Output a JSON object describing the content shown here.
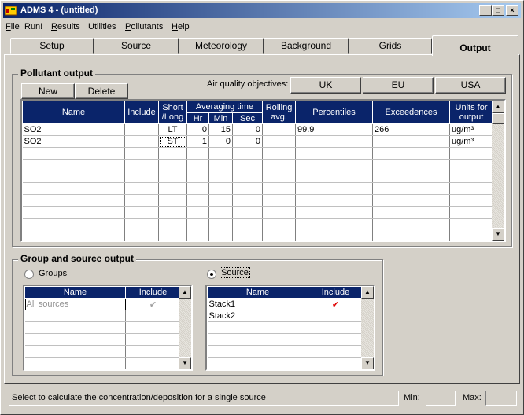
{
  "window": {
    "title": "ADMS 4 - (untitled)",
    "min_label": "_",
    "max_label": "□",
    "close_label": "×"
  },
  "menu": [
    {
      "first": "F",
      "rest": "ile"
    },
    {
      "first": "",
      "rest": "Run!"
    },
    {
      "first": "R",
      "rest": "esults"
    },
    {
      "first": "",
      "rest": "Utilities"
    },
    {
      "first": "P",
      "rest": "ollutants"
    },
    {
      "first": "H",
      "rest": "elp"
    }
  ],
  "tabs": [
    "Setup",
    "Source",
    "Meteorology",
    "Background",
    "Grids",
    "Output"
  ],
  "active_tab": "Output",
  "pollutant_output": {
    "label": "Pollutant output",
    "new_label": "New",
    "delete_label": "Delete",
    "aq_label": "Air quality objectives:",
    "uk_label": "UK",
    "eu_label": "EU",
    "usa_label": "USA",
    "headers": {
      "name": "Name",
      "include": "Include",
      "short_long_1": "Short",
      "short_long_2": "/Long",
      "averaging": "Averaging time",
      "hr": "Hr",
      "min": "Min",
      "sec": "Sec",
      "rolling_1": "Rolling",
      "rolling_2": "avg.",
      "percentiles": "Percentiles",
      "exceedences": "Exceedences",
      "units_1": "Units for",
      "units_2": "output"
    },
    "rows": [
      {
        "name": "SO2",
        "include": "",
        "sl": "LT",
        "hr": "0",
        "min": "15",
        "sec": "0",
        "rolling": "",
        "percentiles": "99.9",
        "exceedences": "266",
        "units": "ug/m³"
      },
      {
        "name": "SO2",
        "include": "",
        "sl": "ST",
        "hr": "1",
        "min": "0",
        "sec": "0",
        "rolling": "",
        "percentiles": "",
        "exceedences": "",
        "units": "ug/m³"
      }
    ]
  },
  "group_source": {
    "label": "Group and source output",
    "groups_label": "Groups",
    "source_label": "Source",
    "selected": "source",
    "groups_headers": {
      "name": "Name",
      "include": "Include"
    },
    "groups_rows": [
      {
        "name": "All sources",
        "include": "✔"
      }
    ],
    "source_headers": {
      "name": "Name",
      "include": "Include"
    },
    "source_rows": [
      {
        "name": "Stack1",
        "include": "✔"
      },
      {
        "name": "Stack2",
        "include": ""
      }
    ]
  },
  "status": {
    "message": "Select to calculate the concentration/deposition for a single source",
    "min_label": "Min:",
    "min_value": "",
    "max_label": "Max:",
    "max_value": ""
  },
  "icons": {
    "up": "▲",
    "down": "▼"
  }
}
